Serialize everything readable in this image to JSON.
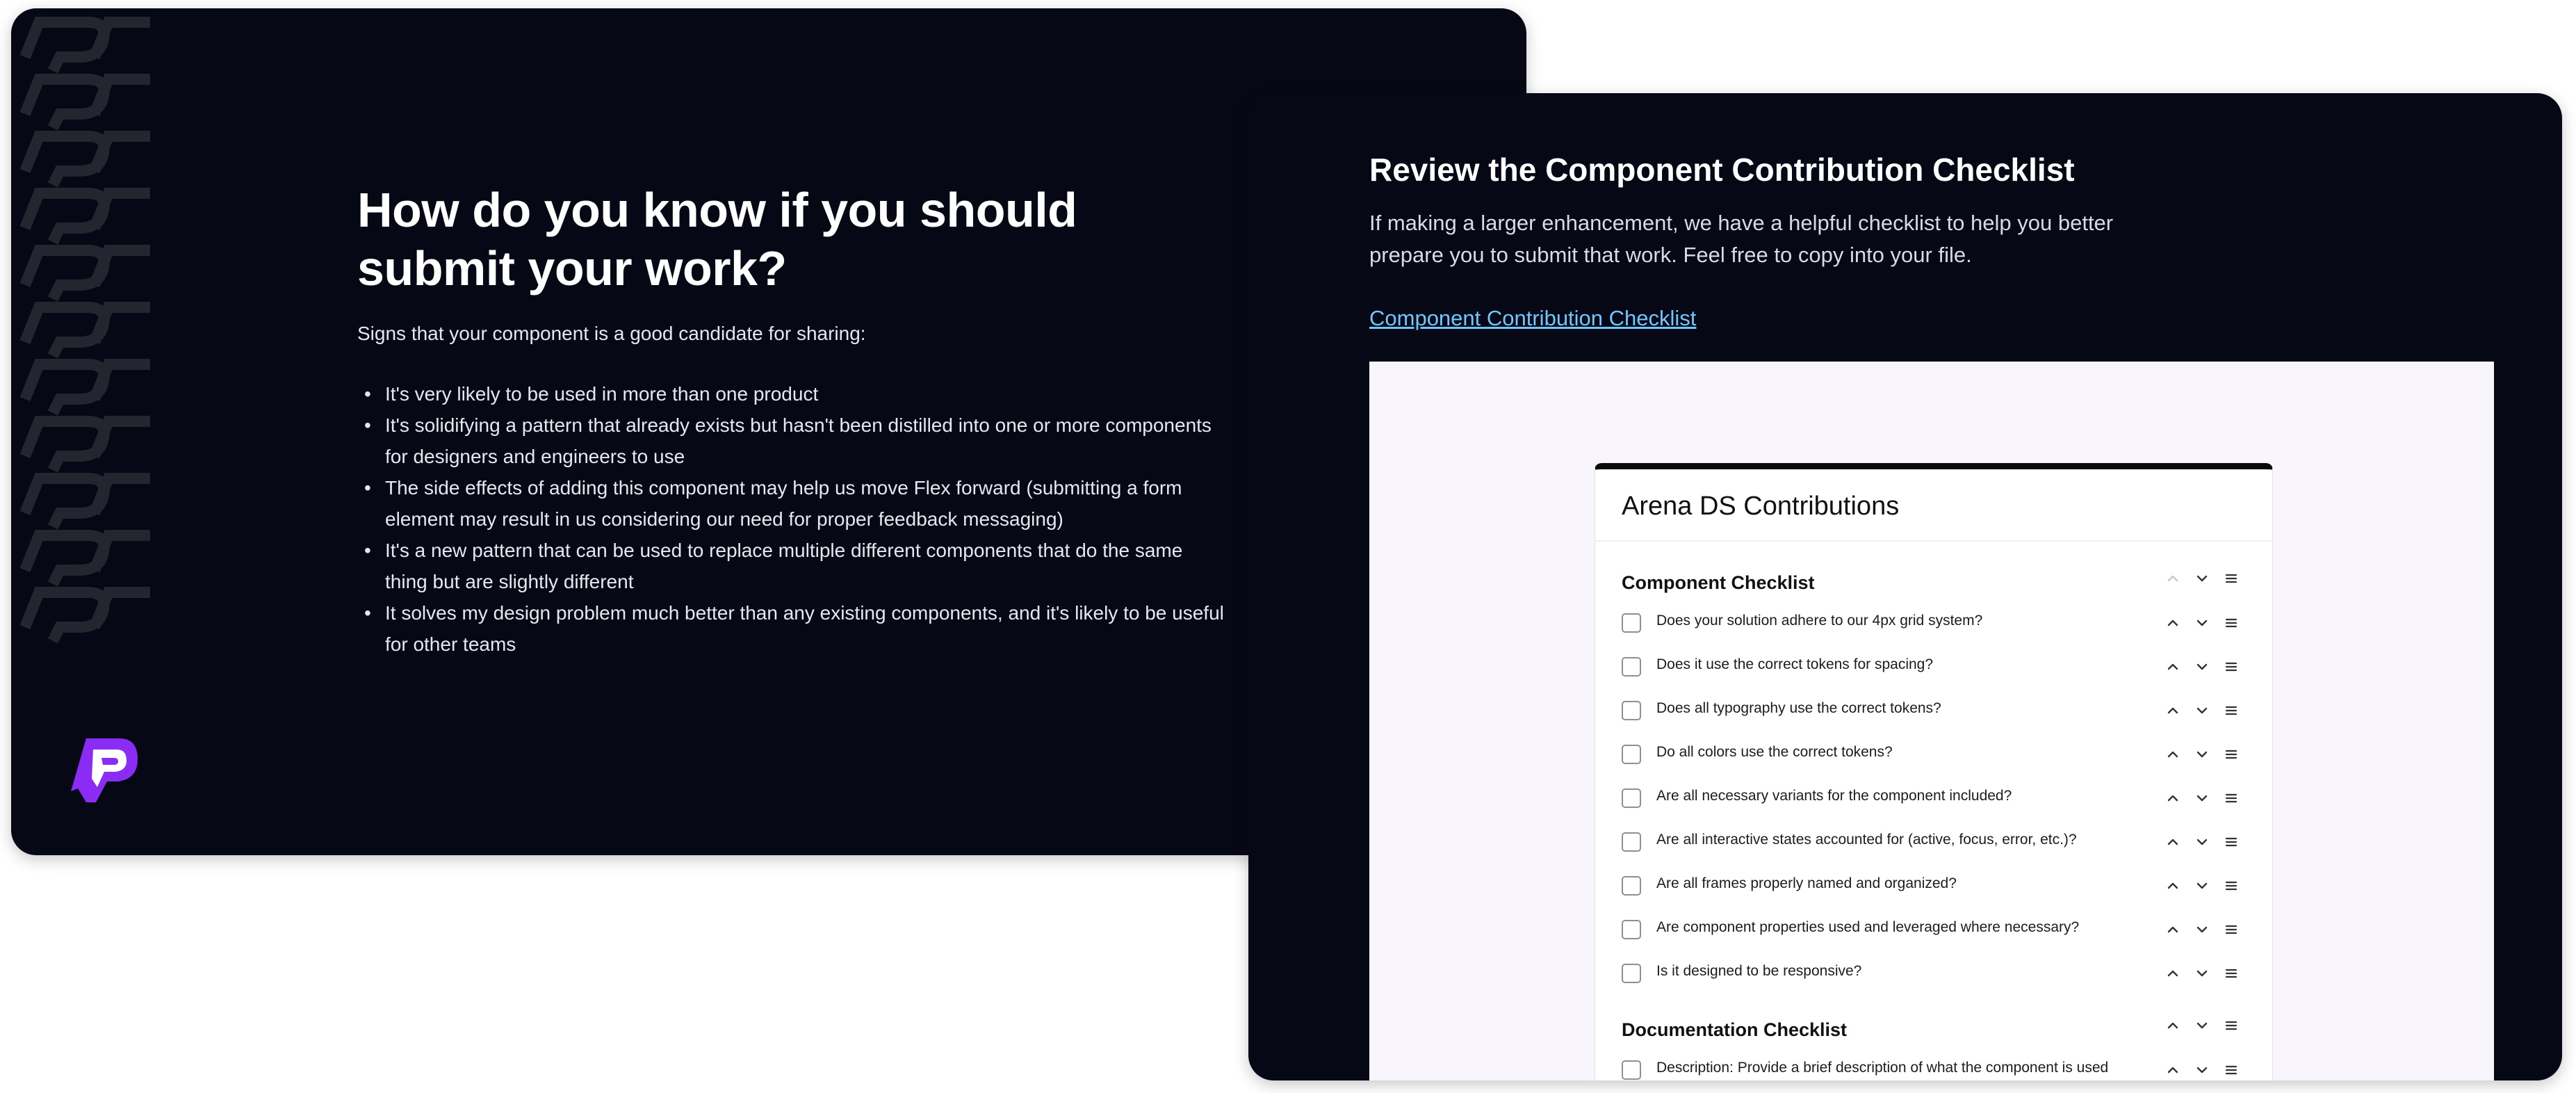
{
  "left_slide": {
    "title": "How do you know if you should submit your work?",
    "intro": "Signs that your component is a good candidate for sharing:",
    "bullets": [
      "It's very likely to be used in more than one product",
      "It's solidifying a pattern that already exists but hasn't been distilled into one or more components for designers and engineers to use",
      "The side effects of adding this component may help us move Flex forward (submitting a form element may result in us considering our need for proper feedback messaging)",
      "It's a new pattern that can be used to replace multiple different components that do the same thing but are slightly different",
      "It solves my design problem much better than any existing components, and it's likely to be useful for other teams"
    ],
    "logo_icon": "brand-logo-icon",
    "logo_color": "#8b2cf5"
  },
  "right_slide": {
    "title": "Review the Component Contribution Checklist",
    "description": "If making a larger enhancement, we have a helpful checklist to help you better prepare you to submit that work. Feel free to copy into your file.",
    "link_text": "Component Contribution Checklist",
    "link_color": "#6ec8ff",
    "form": {
      "title": "Arena DS Contributions",
      "sections": [
        {
          "label": "Component Checklist",
          "items": [
            "Does your solution adhere to our 4px grid system?",
            "Does it use the correct tokens for spacing?",
            "Does all typography use the correct tokens?",
            "Do all colors use the correct tokens?",
            "Are all necessary variants for the component included?",
            "Are all interactive states accounted for (active, focus, error, etc.)?",
            "Are all frames properly named and organized?",
            "Are component properties used and leveraged where necessary?",
            "Is it designed to be responsive?"
          ]
        },
        {
          "label": "Documentation Checklist",
          "items": [
            "Description: Provide a brief description of what the component is used"
          ]
        }
      ]
    }
  }
}
